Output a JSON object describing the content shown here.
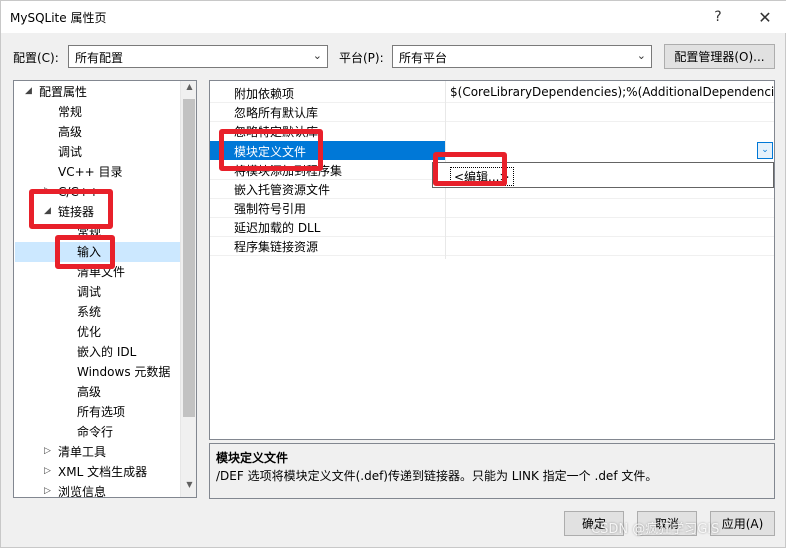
{
  "window": {
    "title": "MySQLite 属性页",
    "help_label": "?",
    "close_label": "✕"
  },
  "config": {
    "label": "配置(C):",
    "value": "所有配置",
    "platform_label": "平台(P):",
    "platform_value": "所有平台",
    "manager_button": "配置管理器(O)..."
  },
  "tree": {
    "items": [
      {
        "label": "配置属性",
        "toggle": "◢"
      },
      {
        "label": "常规"
      },
      {
        "label": "高级"
      },
      {
        "label": "调试"
      },
      {
        "label": "VC++ 目录"
      },
      {
        "label": "C/C++",
        "toggle": "▷"
      },
      {
        "label": "链接器",
        "toggle": "◢"
      },
      {
        "label": "常规"
      },
      {
        "label": "输入"
      },
      {
        "label": "清单文件"
      },
      {
        "label": "调试"
      },
      {
        "label": "系统"
      },
      {
        "label": "优化"
      },
      {
        "label": "嵌入的 IDL"
      },
      {
        "label": "Windows 元数据"
      },
      {
        "label": "高级"
      },
      {
        "label": "所有选项"
      },
      {
        "label": "命令行"
      },
      {
        "label": "清单工具",
        "toggle": "▷"
      },
      {
        "label": "XML 文档生成器",
        "toggle": "▷"
      },
      {
        "label": "浏览信息",
        "toggle": "▷"
      }
    ]
  },
  "grid": {
    "rows": [
      {
        "name": "附加依赖项",
        "value": "$(CoreLibraryDependencies);%(AdditionalDependencies)"
      },
      {
        "name": "忽略所有默认库",
        "value": ""
      },
      {
        "name": "忽略特定默认库",
        "value": ""
      },
      {
        "name": "模块定义文件",
        "value": ""
      },
      {
        "name": "将模块添加到程序集",
        "value": ""
      },
      {
        "name": "嵌入托管资源文件",
        "value": ""
      },
      {
        "name": "强制符号引用",
        "value": ""
      },
      {
        "name": "延迟加载的 DLL",
        "value": ""
      },
      {
        "name": "程序集链接资源",
        "value": ""
      }
    ],
    "dropdown_item": "<编辑...>"
  },
  "description": {
    "title": "模块定义文件",
    "text": "/DEF 选项将模块定义文件(.def)传递到链接器。只能为 LINK 指定一个 .def 文件。"
  },
  "buttons": {
    "ok": "确定",
    "cancel": "取消",
    "apply": "应用(A)"
  },
  "watermark": "CSDN @疯狂学习GIS"
}
